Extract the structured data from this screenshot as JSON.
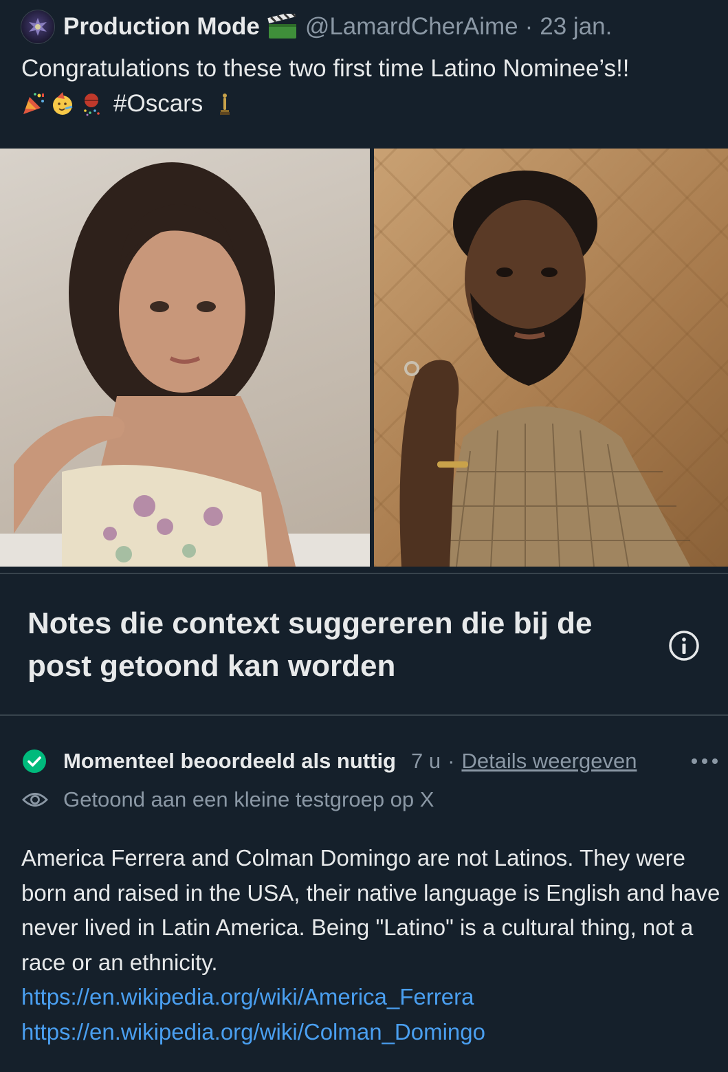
{
  "post": {
    "author_name": "Production Mode",
    "handle": "@LamardCherAime",
    "separator": "·",
    "date": "23 jan.",
    "text": "Congratulations to these two first time Latino Nominee’s!!",
    "hashtag": "#Oscars",
    "emoji_icons": [
      "party-popper-icon",
      "partying-face-icon",
      "confetti-ball-icon",
      "oscar-statuette-icon"
    ]
  },
  "photos": [
    {
      "icon": "portrait-photo-woman"
    },
    {
      "icon": "portrait-photo-man"
    }
  ],
  "notes": {
    "title": "Notes die context suggereren die bij de post getoond kan worden",
    "status_label": "Momenteel beoordeeld als nuttig",
    "age": "7 u",
    "separator": "·",
    "details_link": "Details weergeven",
    "shown_to": "Getoond aan een kleine testgroep op X",
    "body": "America Ferrera and Colman Domingo are not Latinos. They were born and raised in the USA, their native language is English and have never lived in Latin America. Being \"Latino\" is a cultural thing, not a race or an ethnicity.",
    "links": [
      "https://en.wikipedia.org/wiki/America_Ferrera",
      "https://en.wikipedia.org/wiki/Colman_Domingo"
    ]
  },
  "colors": {
    "background": "#15202b",
    "text": "#e7e9ea",
    "muted": "#8b98a5",
    "link": "#4a9ff0",
    "success": "#00ba7c",
    "divider": "#38444d"
  }
}
